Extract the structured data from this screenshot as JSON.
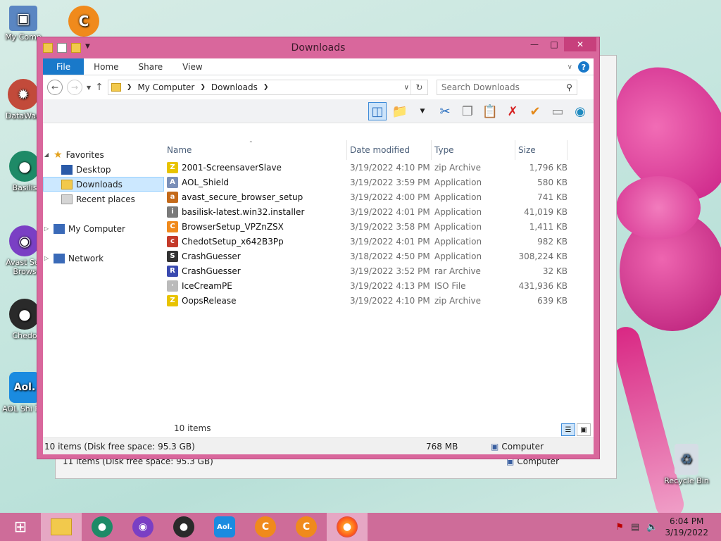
{
  "desktop": {
    "icons": [
      {
        "label": "My Comp",
        "icon": "computer-icon"
      },
      {
        "label": "DataWag",
        "icon": "datawag-icon"
      },
      {
        "label": "Basilis",
        "icon": "basilisk-icon"
      },
      {
        "label": "Avast Sec Brows",
        "icon": "avast-browser-icon"
      },
      {
        "label": "Chedo",
        "icon": "chedot-icon"
      },
      {
        "label": "AOL Shi Pro",
        "icon": "aol-shield-icon"
      },
      {
        "label": "",
        "icon": "browser-c-icon"
      }
    ],
    "recycle_bin": "Recycle Bin"
  },
  "background_window": {
    "status_text": "11 items (Disk free space: 95.3 GB)",
    "computer_label": "Computer"
  },
  "window": {
    "title": "Downloads",
    "ribbon_tabs": [
      "File",
      "Home",
      "Share",
      "View"
    ],
    "address": {
      "crumbs": [
        "My Computer",
        "Downloads"
      ]
    },
    "search_placeholder": "Search Downloads",
    "nav": {
      "favorites": "Favorites",
      "desktop": "Desktop",
      "downloads": "Downloads",
      "recent": "Recent places",
      "computer": "My Computer",
      "network": "Network"
    },
    "columns": {
      "name": "Name",
      "date": "Date modified",
      "type": "Type",
      "size": "Size"
    },
    "files": [
      {
        "name": "2001-ScreensaverSlave",
        "date": "3/19/2022 4:10 PM",
        "type": "zip Archive",
        "size": "1,796 KB",
        "icon": "zip-icon"
      },
      {
        "name": "AOL_Shield",
        "date": "3/19/2022 3:59 PM",
        "type": "Application",
        "size": "580 KB",
        "icon": "aol-icon"
      },
      {
        "name": "avast_secure_browser_setup",
        "date": "3/19/2022 4:00 PM",
        "type": "Application",
        "size": "741 KB",
        "icon": "avast-icon"
      },
      {
        "name": "basilisk-latest.win32.installer",
        "date": "3/19/2022 4:01 PM",
        "type": "Application",
        "size": "41,019 KB",
        "icon": "installer-icon"
      },
      {
        "name": "BrowserSetup_VPZnZSX",
        "date": "3/19/2022 3:58 PM",
        "type": "Application",
        "size": "1,411 KB",
        "icon": "browser-c-icon"
      },
      {
        "name": "ChedotSetup_x642B3Pp",
        "date": "3/19/2022 4:01 PM",
        "type": "Application",
        "size": "982 KB",
        "icon": "chedot-icon"
      },
      {
        "name": "CrashGuesser",
        "date": "3/18/2022 4:50 PM",
        "type": "Application",
        "size": "308,224 KB",
        "icon": "crash-icon"
      },
      {
        "name": "CrashGuesser",
        "date": "3/19/2022 3:52 PM",
        "type": "rar Archive",
        "size": "32 KB",
        "icon": "rar-icon"
      },
      {
        "name": "IceCreamPE",
        "date": "3/19/2022 4:13 PM",
        "type": "ISO File",
        "size": "431,936 KB",
        "icon": "iso-icon"
      },
      {
        "name": "OopsRelease",
        "date": "3/19/2022 4:10 PM",
        "type": "zip Archive",
        "size": "639 KB",
        "icon": "zip-icon"
      }
    ],
    "item_count": "10 items",
    "status": {
      "text": "10 items (Disk free space: 95.3 GB)",
      "size": "768 MB",
      "computer": "Computer"
    }
  },
  "taskbar": {
    "apps": [
      "start-icon",
      "file-explorer-icon",
      "basilisk-icon",
      "avast-browser-icon",
      "chedot-icon",
      "aol-shield-icon",
      "browser-c-icon",
      "browser-c-icon",
      "firefox-icon"
    ],
    "time": "6:04 PM",
    "date": "3/19/2022"
  },
  "colors": {
    "accent": "#1979ca",
    "window_frame": "#d9679c",
    "taskbar": "#ce6c99"
  }
}
